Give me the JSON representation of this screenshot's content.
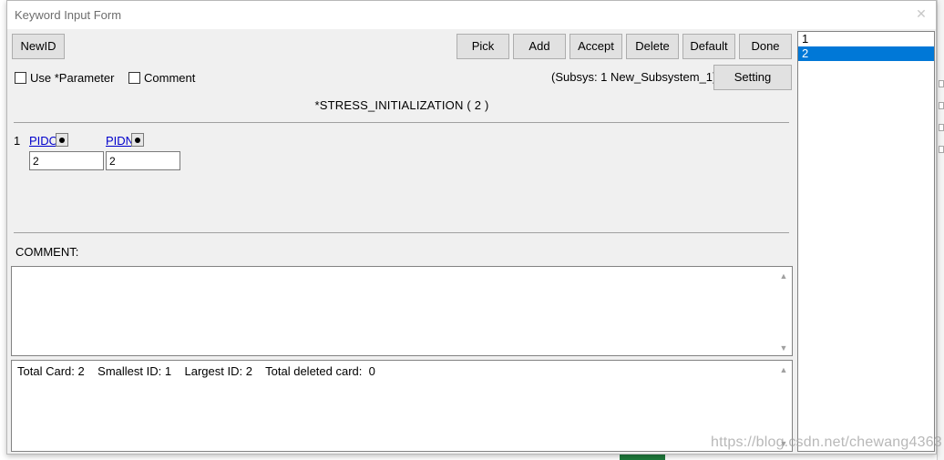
{
  "window": {
    "title": "Keyword Input Form"
  },
  "toolbar": {
    "newid_label": "NewID",
    "pick_label": "Pick",
    "add_label": "Add",
    "accept_label": "Accept",
    "delete_label": "Delete",
    "default_label": "Default",
    "done_label": "Done",
    "setting_label": "Setting"
  },
  "options": {
    "use_parameter_label": "Use *Parameter",
    "use_parameter_checked": false,
    "comment_label": "Comment",
    "comment_checked": false
  },
  "subsystem": {
    "text": "(Subsys: 1 New_Subsystem_1)"
  },
  "keyword": {
    "title": "*STRESS_INITIALIZATION    ( 2 )"
  },
  "card": {
    "row_number": "1",
    "fields": [
      {
        "label": "PIDO",
        "value": "2"
      },
      {
        "label": "PIDN",
        "value": "2"
      }
    ]
  },
  "comment_section": {
    "label": "COMMENT:",
    "value": ""
  },
  "stats": {
    "text": "Total Card: 2    Smallest ID: 1    Largest ID: 2    Total deleted card:  0"
  },
  "id_list": {
    "items": [
      "1",
      "2"
    ],
    "selected": "2"
  },
  "watermark": {
    "text": "https://blog.csdn.net/chewang4363"
  }
}
